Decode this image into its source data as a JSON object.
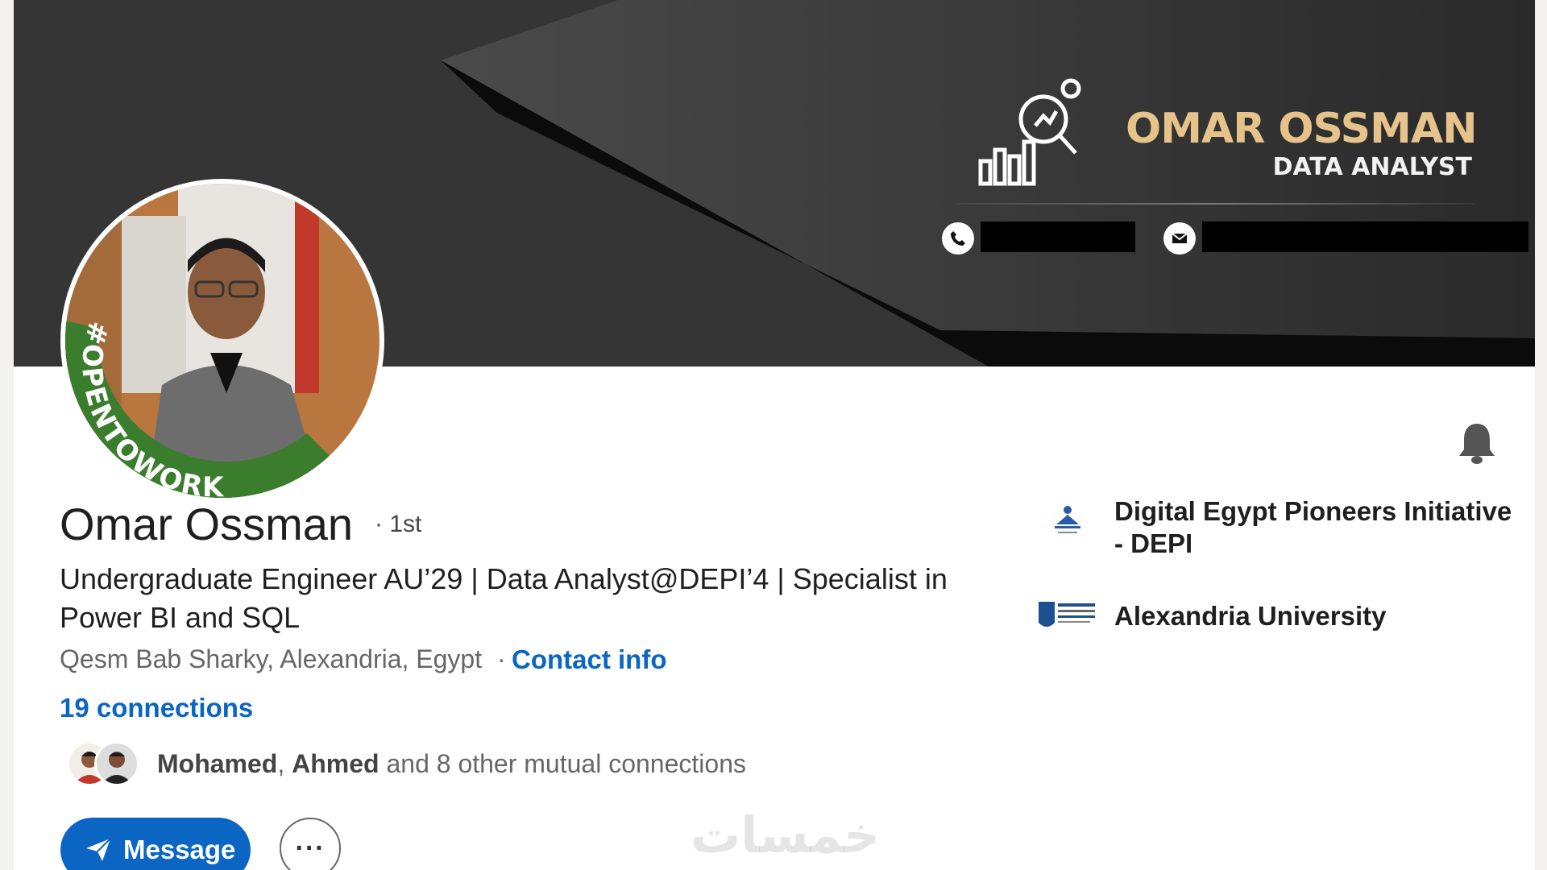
{
  "banner": {
    "brand_name": "OMAR OSSMAN",
    "brand_role": "DATA ANALYST"
  },
  "avatar": {
    "badge_text": "#OPENTOWORK"
  },
  "profile": {
    "name": "Omar Ossman",
    "degree": "· 1st",
    "headline": "Undergraduate Engineer AU’29 | Data Analyst@DEPI’4 | Specialist in Power BI and SQL",
    "location": "Qesm Bab Sharky, Alexandria, Egypt",
    "location_separator": "·",
    "contact_info": "Contact info",
    "connections": "19 connections",
    "mutual": {
      "name1": "Mohamed",
      "separator": ", ",
      "name2": "Ahmed",
      "rest": " and 8 other mutual connections"
    }
  },
  "experience": [
    {
      "name": "Digital Egypt Pioneers Initiative - DEPI"
    },
    {
      "name": "Alexandria University"
    }
  ],
  "actions": {
    "message_label": "Message",
    "more_label": "···"
  },
  "watermark": "خمسات",
  "colors": {
    "accent": "#0a66c2",
    "open_to_work": "#3a7d2c",
    "brand_gold": "#e6c38a"
  }
}
